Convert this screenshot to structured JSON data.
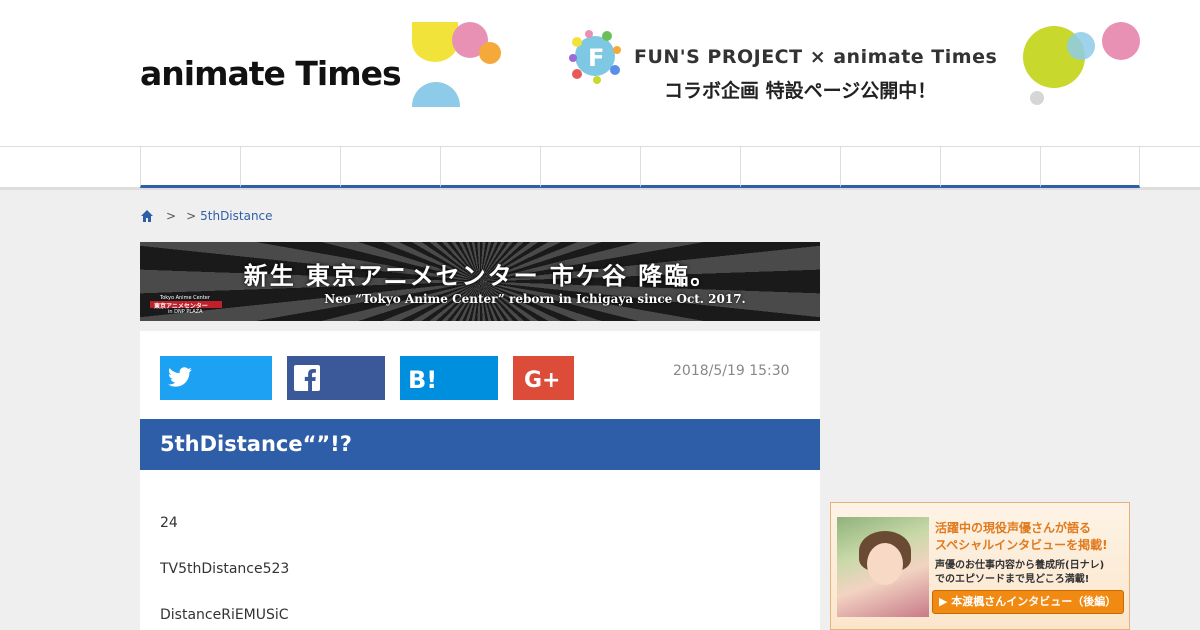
{
  "header": {
    "logo_text": "animate Times",
    "promo": {
      "line1": "FUN'S PROJECT × animate Times",
      "line2": "コラボ企画 特設ページ公開中！",
      "colors": [
        "#f2e33a",
        "#e891b4",
        "#f4a93a",
        "#8ecbe8",
        "#c8d82c",
        "#d6d6d6"
      ]
    }
  },
  "nav": {
    "item_count": 10,
    "accent": "#2f5ea8"
  },
  "breadcrumb": {
    "home_icon": "home-icon",
    "separator1": ">",
    "separator2": ">",
    "current": "5thDistance"
  },
  "banner": {
    "title": "新生 東京アニメセンター 市ケ谷 降臨。",
    "subtitle": "Neo “Tokyo Anime Center” reborn in Ichigaya since Oct. 2017.",
    "logo_top": "Tokyo Anime Center",
    "logo_main": "東京アニメセンター",
    "logo_sub": "in DNP PLAZA"
  },
  "article": {
    "share": {
      "twitter_icon": "twitter-icon",
      "facebook_icon": "facebook-icon",
      "hatena_icon": "hatena-bookmark-icon",
      "google_icon": "google-plus-icon",
      "colors": {
        "twitter": "#1da1f2",
        "facebook": "#3b5998",
        "hatena": "#008fde",
        "google": "#dd4b39"
      }
    },
    "date": "2018/5/19 15:30",
    "title": "5thDistance“”!?",
    "paragraphs": [
      "24",
      "TV5thDistance523",
      "DistanceRiEMUSiC"
    ]
  },
  "sidebar_ad": {
    "heading1": "活躍中の現役声優さんが語る",
    "heading2": "スペシャルインタビューを掲載!",
    "text1": "声優のお仕事内容から養成所(日ナレ)",
    "text2": "でのエピソードまで見どころ満載!",
    "button": "▶ 本渡楓さんインタビュー（後編）"
  }
}
